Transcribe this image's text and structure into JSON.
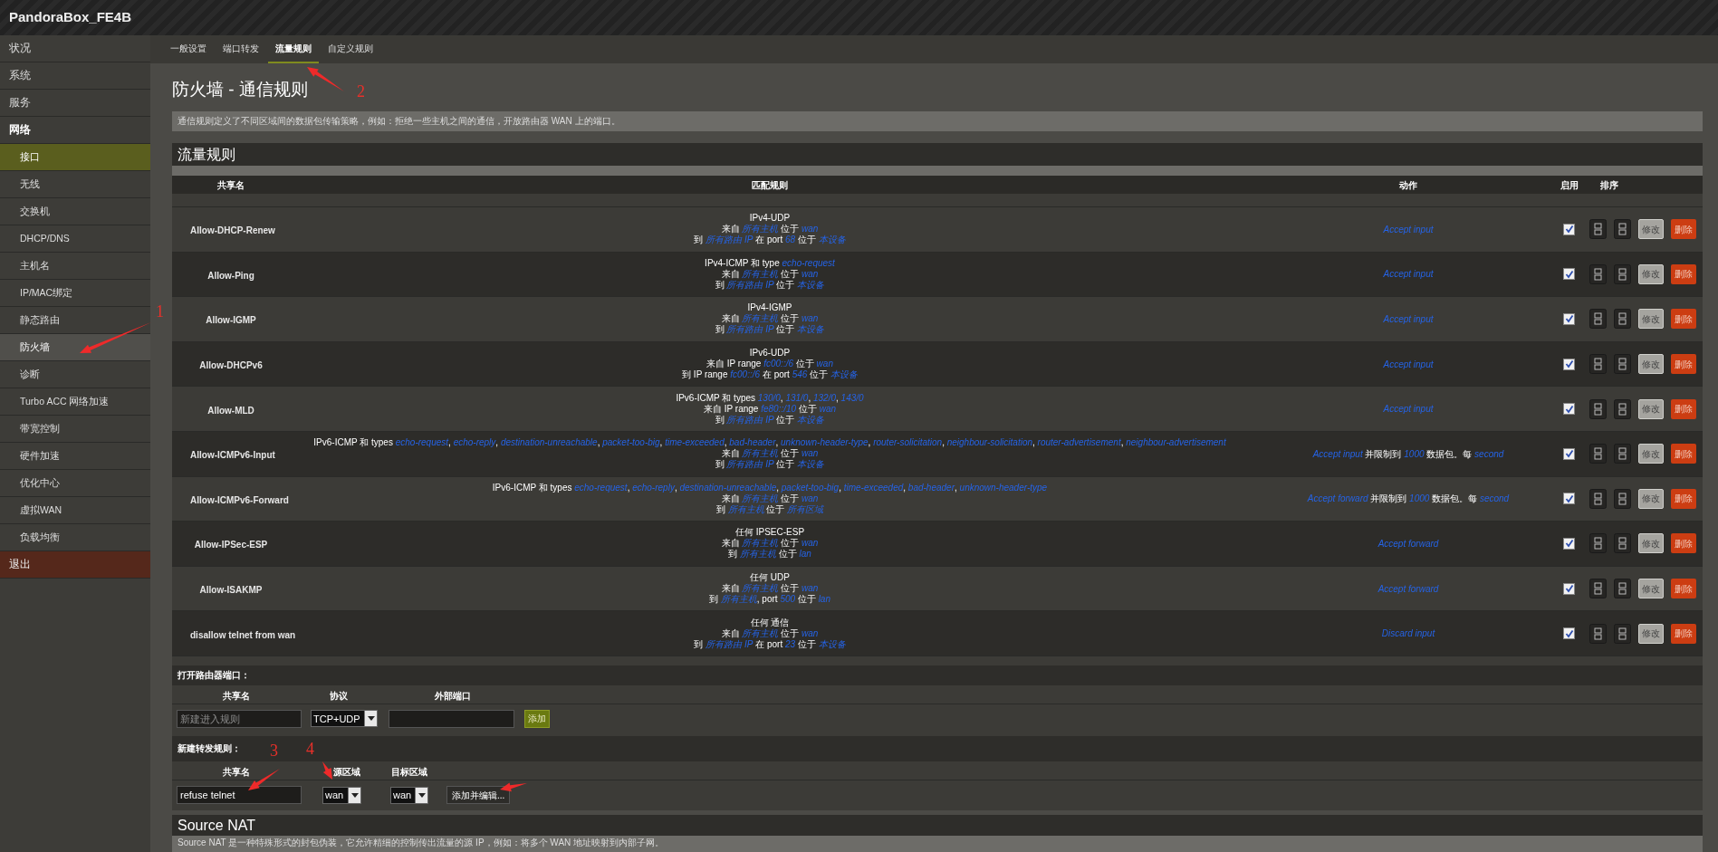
{
  "header": {
    "title": "PandoraBox_FE4B"
  },
  "sidebar": {
    "items": [
      {
        "label": "状况",
        "kind": "menu",
        "expanded": false
      },
      {
        "label": "系统",
        "kind": "menu",
        "expanded": false
      },
      {
        "label": "服务",
        "kind": "menu",
        "expanded": false
      },
      {
        "label": "网络",
        "kind": "menu",
        "expanded": true,
        "children": [
          {
            "label": "接口",
            "selected": true,
            "highlighted": false
          },
          {
            "label": "无线",
            "selected": false,
            "highlighted": false
          },
          {
            "label": "交换机",
            "selected": false,
            "highlighted": false
          },
          {
            "label": "DHCP/DNS",
            "selected": false,
            "highlighted": false
          },
          {
            "label": "主机名",
            "selected": false,
            "highlighted": false
          },
          {
            "label": "IP/MAC绑定",
            "selected": false,
            "highlighted": false
          },
          {
            "label": "静态路由",
            "selected": false,
            "highlighted": false
          },
          {
            "label": "防火墙",
            "selected": false,
            "highlighted": true
          },
          {
            "label": "诊断",
            "selected": false,
            "highlighted": false
          },
          {
            "label": "Turbo ACC 网络加速",
            "selected": false,
            "highlighted": false
          },
          {
            "label": "带宽控制",
            "selected": false,
            "highlighted": false
          },
          {
            "label": "硬件加速",
            "selected": false,
            "highlighted": false
          },
          {
            "label": "优化中心",
            "selected": false,
            "highlighted": false
          },
          {
            "label": "虚拟WAN",
            "selected": false,
            "highlighted": false
          },
          {
            "label": "负载均衡",
            "selected": false,
            "highlighted": false
          }
        ]
      },
      {
        "label": "退出",
        "kind": "logout",
        "expanded": false
      }
    ]
  },
  "tabs": [
    {
      "label": "一般设置",
      "selected": false
    },
    {
      "label": "端口转发",
      "selected": false
    },
    {
      "label": "流量规则",
      "selected": true
    },
    {
      "label": "自定义规则",
      "selected": false
    }
  ],
  "page_title": "防火墙 - 通信规则",
  "description": "通信规则定义了不同区域间的数据包传输策略，例如：拒绝一些主机之间的通信，开放路由器 WAN 上的端口。",
  "rules": {
    "title": "流量规则",
    "columns": [
      "共享名",
      "匹配规则",
      "动作",
      "启用",
      "排序"
    ],
    "rows": [
      {
        "name": "Allow-DHCP-Renew",
        "match": [
          "IPv4-UDP",
          "来自 *所有主机* 位于 *wan*",
          "到 *所有路由 IP* 在 port *68* 位于 *本设备*"
        ],
        "action": "*Accept input*",
        "enabled": true,
        "edit": "修改",
        "delete": "删除"
      },
      {
        "name": "Allow-Ping",
        "match": [
          "IPv4-ICMP 和 type *echo-request*",
          "来自 *所有主机* 位于 *wan*",
          "到 *所有路由 IP* 位于 *本设备*"
        ],
        "action": "*Accept input*",
        "enabled": true,
        "edit": "修改",
        "delete": "删除"
      },
      {
        "name": "Allow-IGMP",
        "match": [
          "IPv4-IGMP",
          "来自 *所有主机* 位于 *wan*",
          "到 *所有路由 IP* 位于 *本设备*"
        ],
        "action": "*Accept input*",
        "enabled": true,
        "edit": "修改",
        "delete": "删除"
      },
      {
        "name": "Allow-DHCPv6",
        "match": [
          "IPv6-UDP",
          "来自 IP range *fc00::/6* 位于 *wan*",
          "到 IP range *fc00::/6* 在 port *546* 位于 *本设备*"
        ],
        "action": "*Accept input*",
        "enabled": true,
        "edit": "修改",
        "delete": "删除"
      },
      {
        "name": "Allow-MLD",
        "match": [
          "IPv6-ICMP 和 types *130/0*, *131/0*, *132/0*, *143/0*",
          "来自 IP range *fe80::/10* 位于 *wan*",
          "到 *所有路由 IP* 位于 *本设备*"
        ],
        "action": "*Accept input*",
        "enabled": true,
        "edit": "修改",
        "delete": "删除"
      },
      {
        "name": "Allow-ICMPv6-Input",
        "match": [
          "IPv6-ICMP 和 types *echo-request*, *echo-reply*, *destination-unreachable*, *packet-too-big*, *time-exceeded*, *bad-header*, *unknown-header-type*, *router-solicitation*, *neighbour-solicitation*, *router-advertisement*, *neighbour-advertisement*",
          "来自 *所有主机* 位于 *wan*",
          "到 *所有路由 IP* 位于 *本设备*"
        ],
        "action": "*Accept input* 并限制到 *1000* 数据包。每 *second*",
        "enabled": true,
        "edit": "修改",
        "delete": "删除"
      },
      {
        "name": "Allow-ICMPv6-Forward",
        "match": [
          "IPv6-ICMP 和 types *echo-request*, *echo-reply*, *destination-unreachable*, *packet-too-big*, *time-exceeded*, *bad-header*, *unknown-header-type*",
          "来自 *所有主机* 位于 *wan*",
          "到 *所有主机* 位于 *所有区域*"
        ],
        "action": "*Accept forward* 并限制到 *1000* 数据包。每 *second*",
        "enabled": true,
        "edit": "修改",
        "delete": "删除"
      },
      {
        "name": "Allow-IPSec-ESP",
        "match": [
          "任何 IPSEC-ESP",
          "来自 *所有主机* 位于 *wan*",
          "到 *所有主机* 位于 *lan*"
        ],
        "action": "*Accept forward*",
        "enabled": true,
        "edit": "修改",
        "delete": "删除"
      },
      {
        "name": "Allow-ISAKMP",
        "match": [
          "任何 UDP",
          "来自 *所有主机* 位于 *wan*",
          "到 *所有主机*, port *500* 位于 *lan*"
        ],
        "action": "*Accept forward*",
        "enabled": true,
        "edit": "修改",
        "delete": "删除"
      },
      {
        "name": "disallow telnet from wan",
        "match": [
          "任何 通信",
          "来自 *所有主机* 位于 *wan*",
          "到 *所有路由 IP* 在 port *23* 位于 *本设备*"
        ],
        "action": "*Discard input*",
        "enabled": true,
        "edit": "修改",
        "delete": "删除"
      }
    ]
  },
  "open_ports": {
    "title": "打开路由器端口：",
    "columns": [
      "共享名",
      "协议",
      "外部端口"
    ],
    "name_placeholder": "新建进入规则",
    "protocol": "TCP+UDP",
    "button": "添加"
  },
  "new_forward": {
    "title": "新建转发规则：",
    "columns": [
      "共享名",
      "源区域",
      "目标区域"
    ],
    "name_value": "refuse telnet",
    "source_zone": "wan",
    "dest_zone": "wan",
    "button": "添加并编辑..."
  },
  "source_nat": {
    "title": "Source NAT",
    "description": "Source NAT 是一种特殊形式的封包伪装，它允许精细的控制传出流量的源 IP，例如：将多个 WAN 地址映射到内部子网。"
  },
  "annotations": [
    {
      "kind": "arrow"
    },
    {
      "kind": "number",
      "label": "1"
    },
    {
      "kind": "arrow"
    },
    {
      "kind": "number",
      "label": "2"
    },
    {
      "kind": "arrow"
    },
    {
      "kind": "number",
      "label": "3"
    },
    {
      "kind": "arrow"
    },
    {
      "kind": "number",
      "label": "4"
    },
    {
      "kind": "arrow"
    }
  ]
}
